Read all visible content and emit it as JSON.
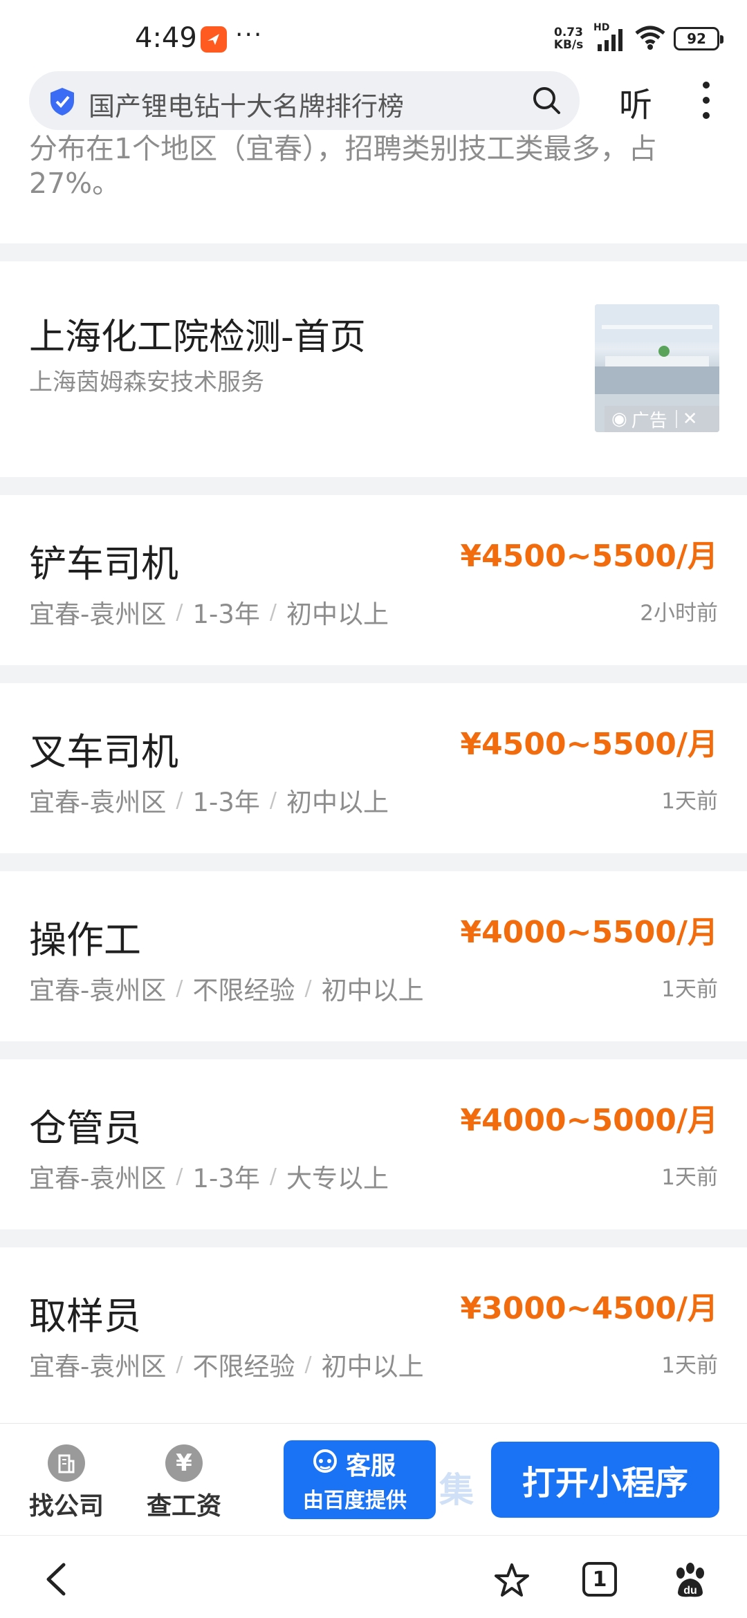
{
  "status_bar": {
    "time": "4:49",
    "more": "···",
    "net_speed_top": "0.73",
    "net_speed_bottom": "KB/s",
    "signal_label": "HD",
    "battery": "92"
  },
  "search": {
    "query": "国产锂电钻十大名牌排行榜",
    "listen_label": "听"
  },
  "summary_text": "分布在1个地区（宜春），招聘类别技工类最多，占27%。",
  "ad": {
    "title": "上海化工院检测-首页",
    "subtitle": "上海茵姆森安技术服务",
    "badge": "广告",
    "close": "✕"
  },
  "jobs": [
    {
      "title": "铲车司机",
      "salary": "¥4500~5500/月",
      "location": "宜春-袁州区",
      "experience": "1-3年",
      "education": "初中以上",
      "time": "2小时前"
    },
    {
      "title": "叉车司机",
      "salary": "¥4500~5500/月",
      "location": "宜春-袁州区",
      "experience": "1-3年",
      "education": "初中以上",
      "time": "1天前"
    },
    {
      "title": "操作工",
      "salary": "¥4000~5500/月",
      "location": "宜春-袁州区",
      "experience": "不限经验",
      "education": "初中以上",
      "time": "1天前"
    },
    {
      "title": "仓管员",
      "salary": "¥4000~5000/月",
      "location": "宜春-袁州区",
      "experience": "1-3年",
      "education": "大专以上",
      "time": "1天前"
    },
    {
      "title": "取样员",
      "salary": "¥3000~4500/月",
      "location": "宜春-袁州区",
      "experience": "不限经验",
      "education": "初中以上",
      "time": "1天前"
    }
  ],
  "action_bar": {
    "find_company": "找公司",
    "check_salary": "查工资",
    "yen_symbol": "¥",
    "service_label": "客服",
    "service_provider": "由百度提供",
    "collect_label": "集",
    "open_miniapp": "打开小程序"
  },
  "browser_nav": {
    "tabs_count": "1"
  },
  "colors": {
    "accent_blue": "#1a73f5",
    "salary_orange": "#f26b0c",
    "divider_gray": "#f2f3f5"
  }
}
